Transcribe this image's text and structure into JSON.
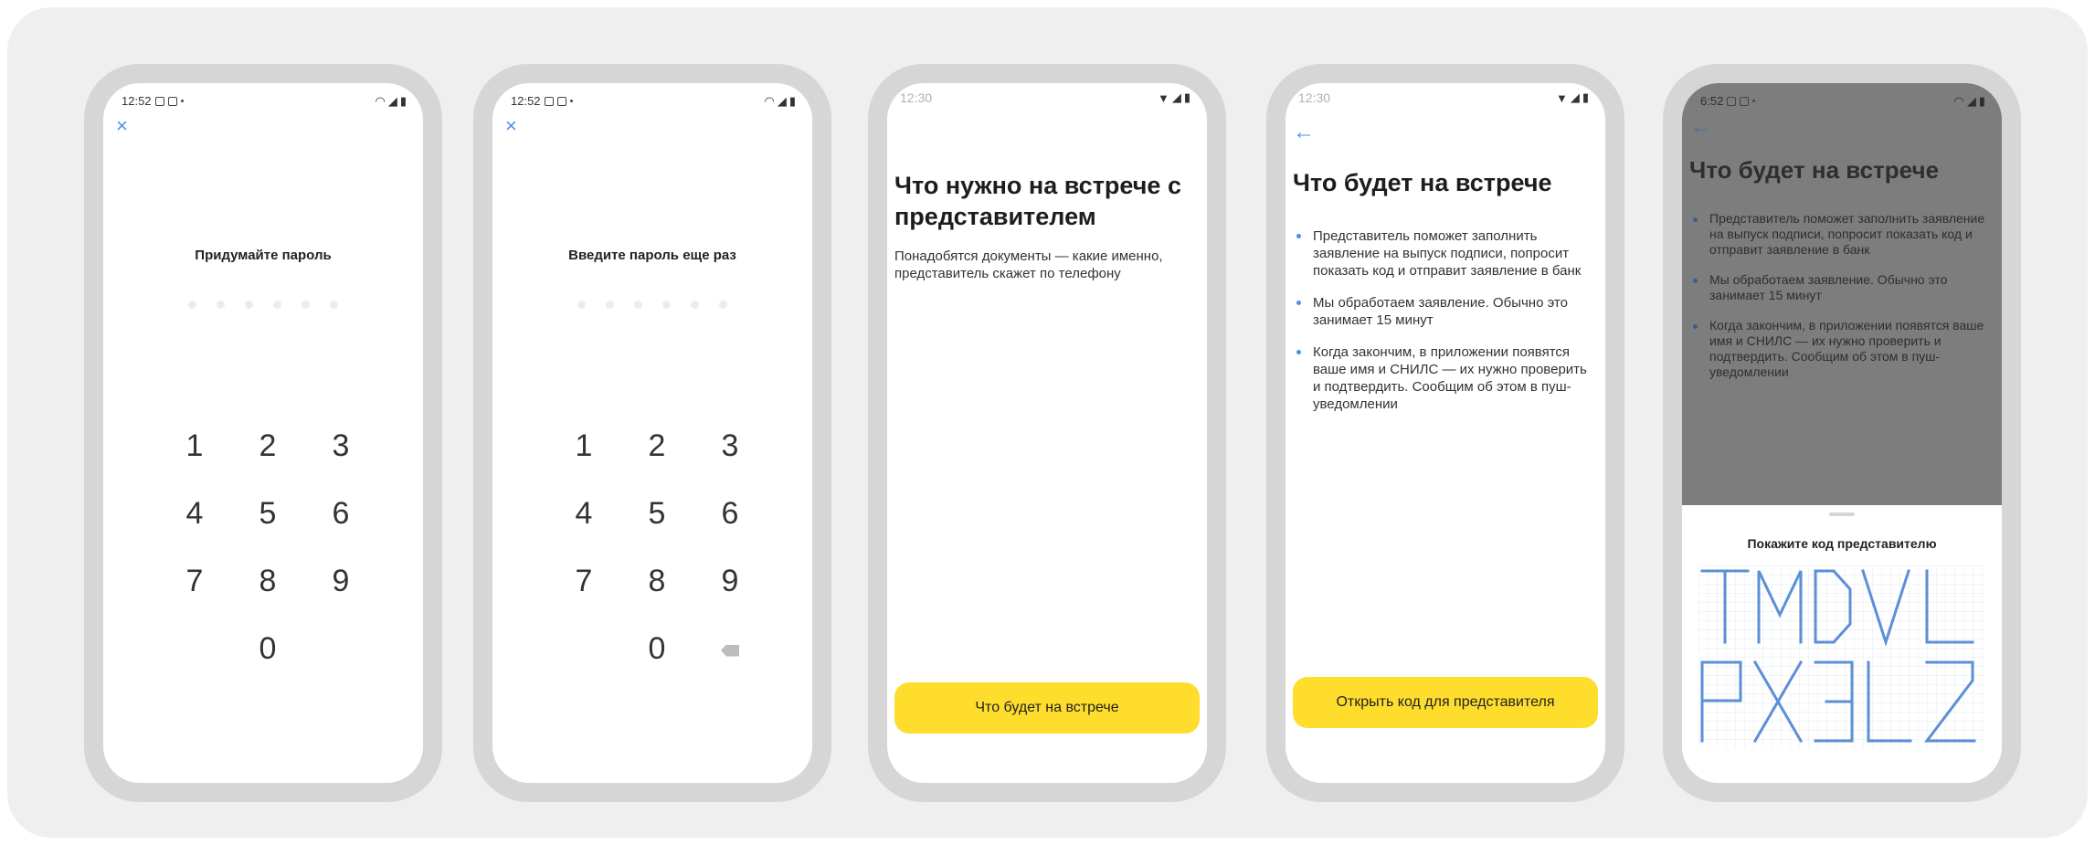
{
  "screens": [
    {
      "status_time": "12:52",
      "title": "Придумайте пароль",
      "keys": [
        "1",
        "2",
        "3",
        "4",
        "5",
        "6",
        "7",
        "8",
        "9",
        "",
        "0",
        ""
      ]
    },
    {
      "status_time": "12:52",
      "title": "Введите пароль еще раз",
      "keys": [
        "1",
        "2",
        "3",
        "4",
        "5",
        "6",
        "7",
        "8",
        "9",
        "",
        "0",
        "backspace"
      ]
    },
    {
      "status_time": "12:30",
      "heading": "Что нужно на встрече с представителем",
      "body": "Понадобятся документы — какие именно, представитель скажет по телефону",
      "button_label": "Что будет на встрече"
    },
    {
      "status_time": "12:30",
      "heading": "Что будет на встрече",
      "bullets": [
        "Представитель поможет заполнить заявление на выпуск подписи, попросит показать код и отправит заявление в банк",
        "Мы обработаем заявление. Обычно это занимает 15 минут",
        "Когда закончим, в приложении появятся ваше имя и СНИЛС — их нужно проверить и подтвердить. Сообщим об этом в пуш-уведомлении"
      ],
      "button_label": "Открыть код для представителя"
    },
    {
      "status_time": "6:52",
      "heading": "Что будет на встрече",
      "bullets": [
        "Представитель поможет заполнить заявление на выпуск подписи, попросит показать код и отправит заявление в банк",
        "Мы обработаем заявление. Обычно это занимает 15 минут",
        "Когда закончим, в приложении появятся ваше имя и СНИЛС — их нужно проверить и подтвердить. Сообщим об этом в пуш-уведомлении"
      ],
      "sheet_title": "Покажите код представителю",
      "code_rows": [
        "TMDVL",
        "PX3L2"
      ]
    }
  ],
  "icons": {
    "close": "×",
    "back": "←",
    "backspace": "backspace-icon"
  },
  "colors": {
    "accent_blue": "#4a90e2",
    "button_yellow": "#ffdd2d",
    "code_blue": "#5b8fd6"
  }
}
